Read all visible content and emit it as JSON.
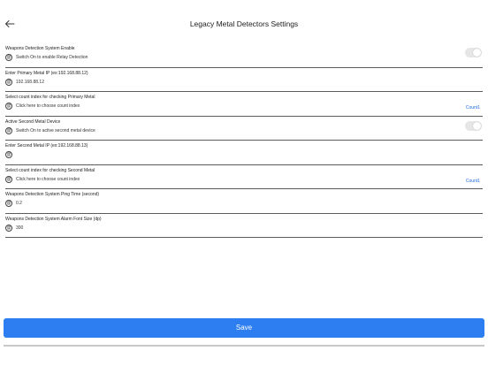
{
  "header": {
    "title": "Legacy Metal Detectors Settings",
    "back_icon": "arrow-left-icon"
  },
  "rows": [
    {
      "label": "Weapons Detection System Enable",
      "value": "Switch On to enable Relay Detection",
      "control": "toggle",
      "toggle_on": false
    },
    {
      "label": "Enter Primary Metal IP (ex:192.168.88.12)",
      "value": "192.168.88.12",
      "control": "input"
    },
    {
      "label": "Select count index for checking Primary Metal",
      "value": "Click here to choose count index",
      "control": "select",
      "link": "Count1"
    },
    {
      "label": "Active Second Metal Device",
      "value": "Switch On to active second metal device",
      "control": "toggle",
      "toggle_on": false
    },
    {
      "label": "Enter Second Metal IP (ex:192.168.88.13)",
      "value": "",
      "control": "input"
    },
    {
      "label": "Select count index for checking Second Metal",
      "value": "Click here to choose count index",
      "control": "select",
      "link": "Count1"
    },
    {
      "label": "Weapons Detection System Ping Time (second)",
      "value": "0.2",
      "control": "input"
    },
    {
      "label": "Weapons Detection System Alarm Font Size (dp)",
      "value": "300",
      "control": "input"
    }
  ],
  "footer": {
    "save_label": "Save"
  },
  "colors": {
    "accent": "#2d7ef0",
    "link": "#1f6fe0",
    "toggle_off": "#e6e6e6",
    "divider": "#5c5c5c"
  }
}
